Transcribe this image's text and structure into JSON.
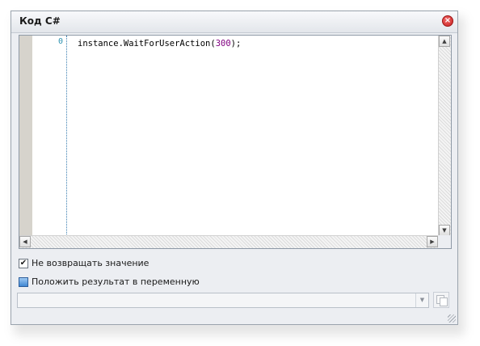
{
  "dialog": {
    "title": "Код C#",
    "close_icon": "close-icon"
  },
  "editor": {
    "line_number": "0",
    "code_prefix": "instance.WaitForUserAction(",
    "code_arg": "300",
    "code_suffix": ");",
    "scroll_up": "▲",
    "scroll_down": "▼",
    "scroll_left": "◀",
    "scroll_right": "▶"
  },
  "options": {
    "no_return_checkbox": {
      "label": "Не возвращать значение",
      "checked": true,
      "mark": "✔"
    },
    "store_result": {
      "label": "Положить результат в переменную",
      "icon": "variable-icon"
    }
  },
  "variable_select": {
    "value": "",
    "arrow": "▼"
  },
  "colors": {
    "line_number": "#2b91af",
    "number_literal": "#800080",
    "close_button": "#c8201f"
  }
}
